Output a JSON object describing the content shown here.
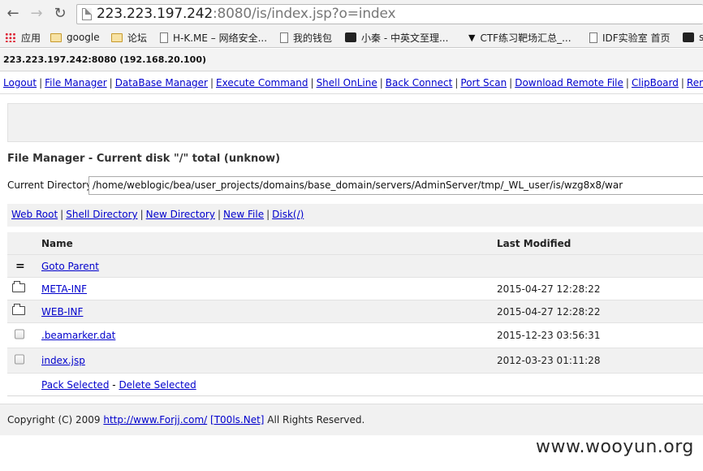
{
  "browser": {
    "back_icon": "arrow-left",
    "forward_icon": "arrow-right",
    "reload_icon": "reload",
    "url_host": "223.223.197.242",
    "url_rest": ":8080/is/index.jsp?o=index"
  },
  "bookmarks": [
    {
      "icon": "apps-grid",
      "label": "应用"
    },
    {
      "icon": "folder",
      "label": "google"
    },
    {
      "icon": "folder",
      "label": "论坛"
    },
    {
      "icon": "page",
      "label": "H-K.ME – 网络安全..."
    },
    {
      "icon": "page",
      "label": "我的钱包"
    },
    {
      "icon": "avatar",
      "label": "小秦 - 中英文至理..."
    },
    {
      "icon": "shoe",
      "label": "CTF练习靶场汇总_..."
    },
    {
      "icon": "page",
      "label": "IDF实验室 首页"
    },
    {
      "icon": "dark",
      "label": "s"
    }
  ],
  "host_info": "223.223.197.242:8080 (192.168.20.100)",
  "menu": [
    "Logout",
    "File Manager",
    "DataBase Manager",
    "Execute Command",
    "Shell OnLine",
    "Back Connect",
    "Port Scan",
    "Download Remote File",
    "ClipBoard",
    "Remote Control"
  ],
  "file_manager": {
    "title": "File Manager - Current disk \"/\" total (unknow)",
    "current_dir_label": "Current Directory",
    "current_dir_value": "/home/weblogic/bea/user_projects/domains/base_domain/servers/AdminServer/tmp/_WL_user/is/wzg8x8/war",
    "quick_links": [
      "Web Root",
      "Shell Directory",
      "New Directory",
      "New File",
      "Disk(/)"
    ],
    "columns": {
      "name": "Name",
      "modified": "Last Modified"
    },
    "rows": [
      {
        "icon": "parent",
        "name": "Goto Parent",
        "modified": ""
      },
      {
        "icon": "folder",
        "name": "META-INF",
        "modified": "2015-04-27 12:28:22"
      },
      {
        "icon": "folder",
        "name": "WEB-INF",
        "modified": "2015-04-27 12:28:22"
      },
      {
        "icon": "checkbox",
        "name": ".beamarker.dat",
        "modified": "2015-12-23 03:56:31"
      },
      {
        "icon": "checkbox",
        "name": "index.jsp",
        "modified": "2012-03-23 01:11:28"
      }
    ],
    "actions": {
      "pack": "Pack Selected",
      "separator": "-",
      "delete": "Delete Selected"
    }
  },
  "footer": {
    "prefix": "Copyright (C) 2009",
    "link1": "http://www.Forjj.com/",
    "link2": "[T00ls.Net]",
    "suffix": "All Rights Reserved."
  },
  "watermark": "www.wooyun.org"
}
